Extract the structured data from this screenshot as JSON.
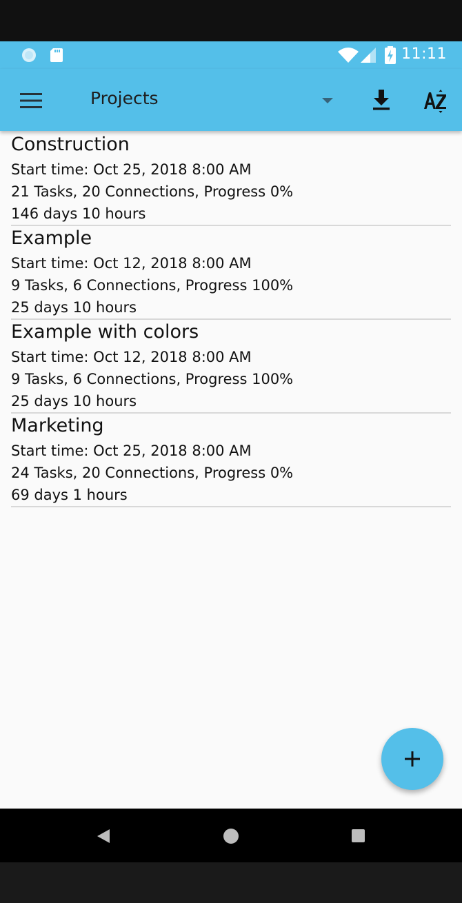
{
  "colors": {
    "accent": "#54bfe9",
    "background": "#fafafa",
    "divider": "#d8d8d8"
  },
  "status_bar": {
    "time": "11:11",
    "icons": [
      "circle-notification-icon",
      "sd-card-icon",
      "wifi-icon",
      "cell-signal-icon",
      "battery-charging-icon"
    ]
  },
  "toolbar": {
    "title": "Projects",
    "icons": [
      "menu-icon",
      "dropdown-arrow-icon",
      "download-icon",
      "sort-az-icon"
    ]
  },
  "projects": [
    {
      "name": "Construction",
      "start": "Start time: Oct 25, 2018 8:00 AM",
      "stats": "21 Tasks, 20 Connections, Progress 0%",
      "duration": "146 days 10 hours"
    },
    {
      "name": "Example",
      "start": "Start time: Oct 12, 2018 8:00 AM",
      "stats": "9 Tasks, 6 Connections, Progress 100%",
      "duration": "25 days 10 hours"
    },
    {
      "name": "Example with colors",
      "start": "Start time: Oct 12, 2018 8:00 AM",
      "stats": "9 Tasks, 6 Connections, Progress 100%",
      "duration": "25 days 10 hours"
    },
    {
      "name": "Marketing",
      "start": "Start time: Oct 25, 2018 8:00 AM",
      "stats": "24 Tasks, 20 Connections, Progress 0%",
      "duration": "69 days 1 hours"
    }
  ],
  "fab": {
    "icon": "plus-icon"
  },
  "nav_bar": {
    "icons": [
      "back-icon",
      "home-icon",
      "recents-icon"
    ]
  }
}
